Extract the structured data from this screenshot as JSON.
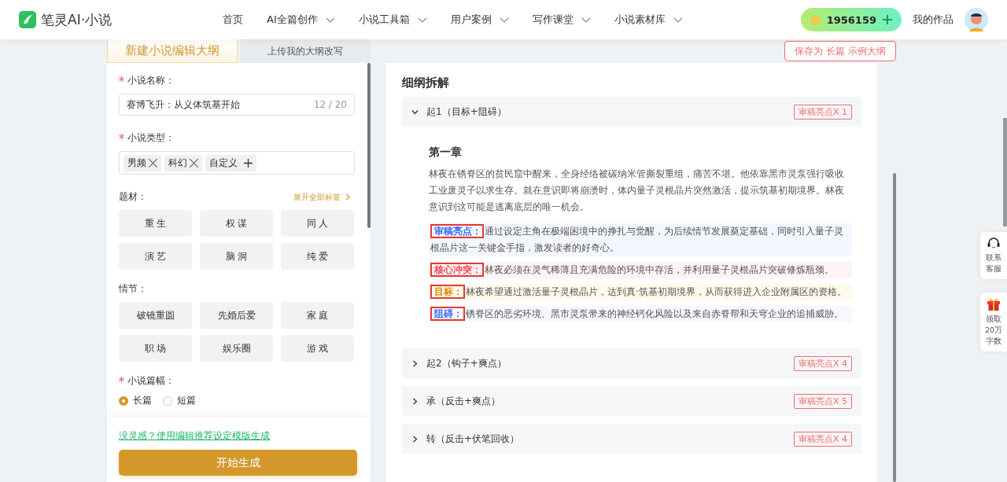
{
  "header": {
    "logo": "笔灵AI·小说",
    "nav": [
      {
        "label": "首页",
        "dropdown": false
      },
      {
        "label": "AI全篇创作",
        "dropdown": true
      },
      {
        "label": "小说工具箱",
        "dropdown": true
      },
      {
        "label": "用户案例",
        "dropdown": true
      },
      {
        "label": "写作课堂",
        "dropdown": true
      },
      {
        "label": "小说素材库",
        "dropdown": true
      }
    ],
    "coins": "1956159",
    "my_works": "我的作品"
  },
  "tabs": [
    {
      "label": "新建小说编辑大纲",
      "selected": true
    },
    {
      "label": "上传我的大纲改写",
      "selected": false
    }
  ],
  "form": {
    "name_field": {
      "label": "小说名称：",
      "required": true,
      "value": "赛博飞升：从义体筑基开始",
      "counter": "12 / 20"
    },
    "type_field": {
      "label": "小说类型：",
      "required": true,
      "tags": [
        {
          "label": "男频",
          "kind": "removable"
        },
        {
          "label": "科幻",
          "kind": "removable"
        },
        {
          "label": "自定义",
          "kind": "add"
        }
      ]
    },
    "subject": {
      "label": "题材：",
      "expand_link": "展开全部标签",
      "options": [
        "重 生",
        "权 谋",
        "同 人",
        "演 艺",
        "脑 洞",
        "纯 爱"
      ]
    },
    "plot": {
      "label": "情节：",
      "options": [
        "破镜重圆",
        "先婚后爱",
        "家 庭",
        "职 场",
        "娱乐圈",
        "游 戏"
      ]
    },
    "length": {
      "label": "小说篇幅：",
      "required": true,
      "options": [
        {
          "label": "长篇",
          "selected": true
        },
        {
          "label": "短篇",
          "selected": false
        }
      ]
    }
  },
  "footer": {
    "link": "没灵感？使用编辑推荐设定模版生成",
    "button": "开始生成"
  },
  "save_button": "保存为 长篇 示例大纲",
  "outline": {
    "title": "细纲拆解",
    "sections": [
      {
        "title": "起1（目标+阻碍）",
        "badge": "审稿亮点X 1",
        "expanded": true,
        "chapter_title": "第一章",
        "summary": "林夜在锈脊区的贫民窟中醒来，全身经络被碳纳米管撕裂重组，痛苦不堪。他依靠黑市灵泵强行吸收工业废灵子以求生存。就在意识即将崩溃时，体内量子灵根晶片突然激活，提示筑基初期境界。林夜意识到这可能是逃离底层的唯一机会。",
        "notes": [
          {
            "kind": "highlight",
            "label": "审稿亮点：",
            "text": "通过设定主角在极端困境中的挣扎与觉醒，为后续情节发展奠定基础，同时引入量子灵根晶片这一关键金手指，激发读者的好奇心。"
          },
          {
            "kind": "conflict",
            "label": "核心冲突：",
            "text": "林夜必须在灵气稀薄且充满危险的环境中存活，并利用量子灵根晶片突破修炼瓶颈。"
          },
          {
            "kind": "goal",
            "label": "目标：",
            "text": "林夜希望通过激活量子灵根晶片，达到真·筑基初期境界，从而获得进入企业附属区的资格。"
          },
          {
            "kind": "obstacle",
            "label": "阻碍：",
            "text": "锈脊区的恶劣环境、黑市灵泵带来的神经钙化风险以及来自赤脊帮和天穹企业的追捕威胁。"
          }
        ]
      },
      {
        "title": "起2（钩子+爽点）",
        "badge": "审稿亮点X 4",
        "expanded": false
      },
      {
        "title": "承（反击+爽点）",
        "badge": "审稿亮点X 5",
        "expanded": false
      },
      {
        "title": "转（反击+伏笔回收）",
        "badge": "审稿亮点X 4",
        "expanded": false
      }
    ]
  },
  "side_widgets": [
    {
      "kind": "support",
      "label": "联系客服"
    },
    {
      "kind": "gift",
      "label": "领取20万字数"
    }
  ]
}
